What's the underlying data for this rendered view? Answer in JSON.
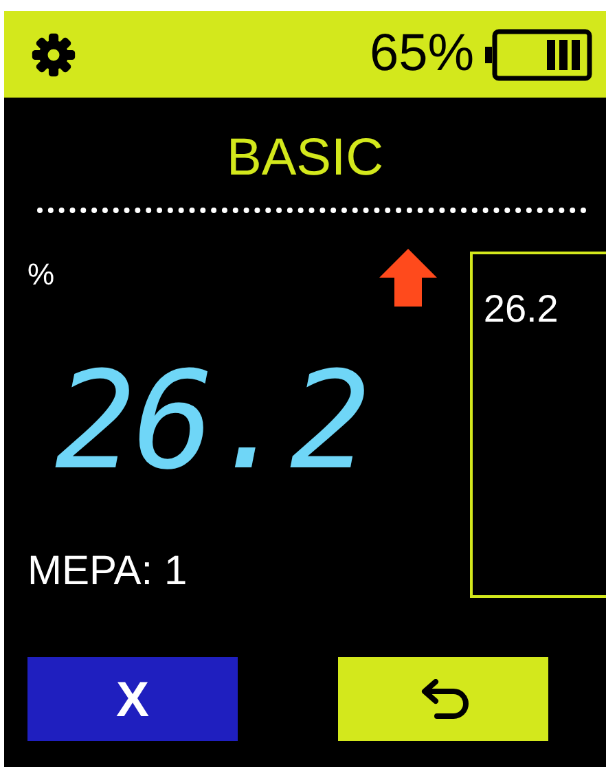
{
  "status_bar": {
    "battery_text": "65%"
  },
  "mode": {
    "title": "BASIC"
  },
  "reading": {
    "unit": "%",
    "rising": true,
    "value": "26.2",
    "measure_label": "MEPA: 1"
  },
  "history_panel": {
    "entries": [
      "26.2"
    ]
  },
  "buttons": [
    {
      "kind": "text",
      "label": "X"
    },
    {
      "kind": "back"
    }
  ]
}
